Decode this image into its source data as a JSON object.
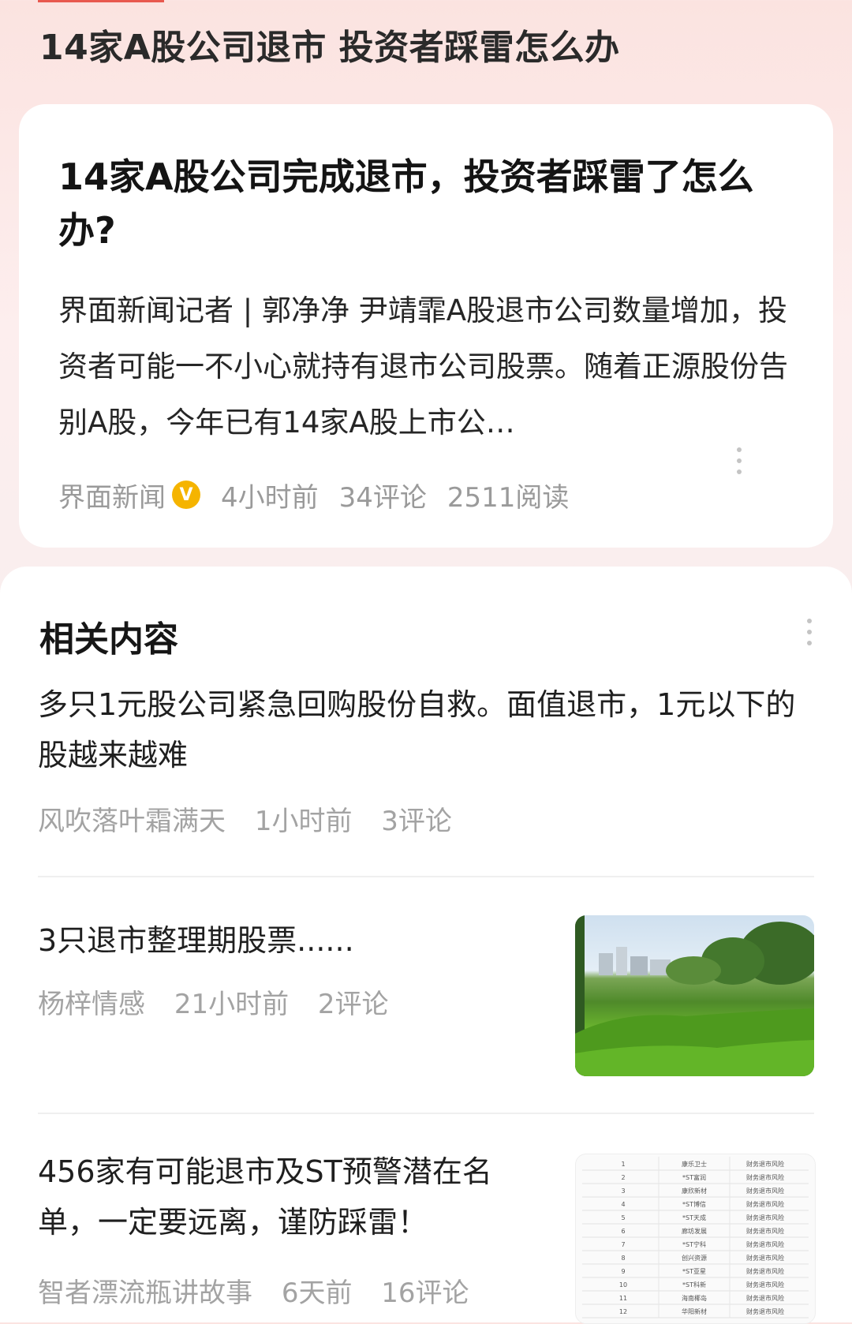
{
  "header": {
    "title": "14家A股公司退市 投资者踩雷怎么办"
  },
  "main_article": {
    "title": "14家A股公司完成退市，投资者踩雷了怎么办?",
    "snippet": "界面新闻记者 | 郭净净 尹靖霏A股退市公司数量增加，投资者可能一不小心就持有退市公司股票。随着正源股份告别A股，今年已有14家A股上市公…",
    "source": "界面新闻",
    "verified_mark": "V",
    "time": "4小时前",
    "comments": "34评论",
    "reads": "2511阅读",
    "accent_color": "#f5b400"
  },
  "related": {
    "heading": "相关内容",
    "items": [
      {
        "title": "多只1元股公司紧急回购股份自救。面值退市，1元以下的股越来越难",
        "author": "风吹落叶霜满天",
        "time": "1小时前",
        "comments": "3评论"
      },
      {
        "title": "3只退市整理期股票......",
        "author": "杨梓情感",
        "time": "21小时前",
        "comments": "2评论",
        "thumbnail": "grass-park-photo"
      },
      {
        "title": "456家有可能退市及ST预警潜在名单，一定要远离，谨防踩雷！",
        "author": "智者漂流瓶讲故事",
        "time": "6天前",
        "comments": "16评论",
        "thumbnail": "stock-list-table-image"
      }
    ]
  },
  "thumbnail_table": {
    "rows": [
      {
        "n": "1",
        "name": "康乐卫士",
        "risk": "财务退市风险"
      },
      {
        "n": "2",
        "name": "*ST富润",
        "risk": "财务退市风险"
      },
      {
        "n": "3",
        "name": "康欣新材",
        "risk": "财务退市风险"
      },
      {
        "n": "4",
        "name": "*ST博信",
        "risk": "财务退市风险"
      },
      {
        "n": "5",
        "name": "*ST天成",
        "risk": "财务退市风险"
      },
      {
        "n": "6",
        "name": "廊坊发展",
        "risk": "财务退市风险"
      },
      {
        "n": "7",
        "name": "*ST宁科",
        "risk": "财务退市风险"
      },
      {
        "n": "8",
        "name": "创兴资源",
        "risk": "财务退市风险"
      },
      {
        "n": "9",
        "name": "*ST亚星",
        "risk": "财务退市风险"
      },
      {
        "n": "10",
        "name": "*ST科新",
        "risk": "财务退市风险"
      },
      {
        "n": "11",
        "name": "海南椰岛",
        "risk": "财务退市风险"
      },
      {
        "n": "12",
        "name": "华阳新材",
        "risk": "财务退市风险"
      }
    ]
  }
}
